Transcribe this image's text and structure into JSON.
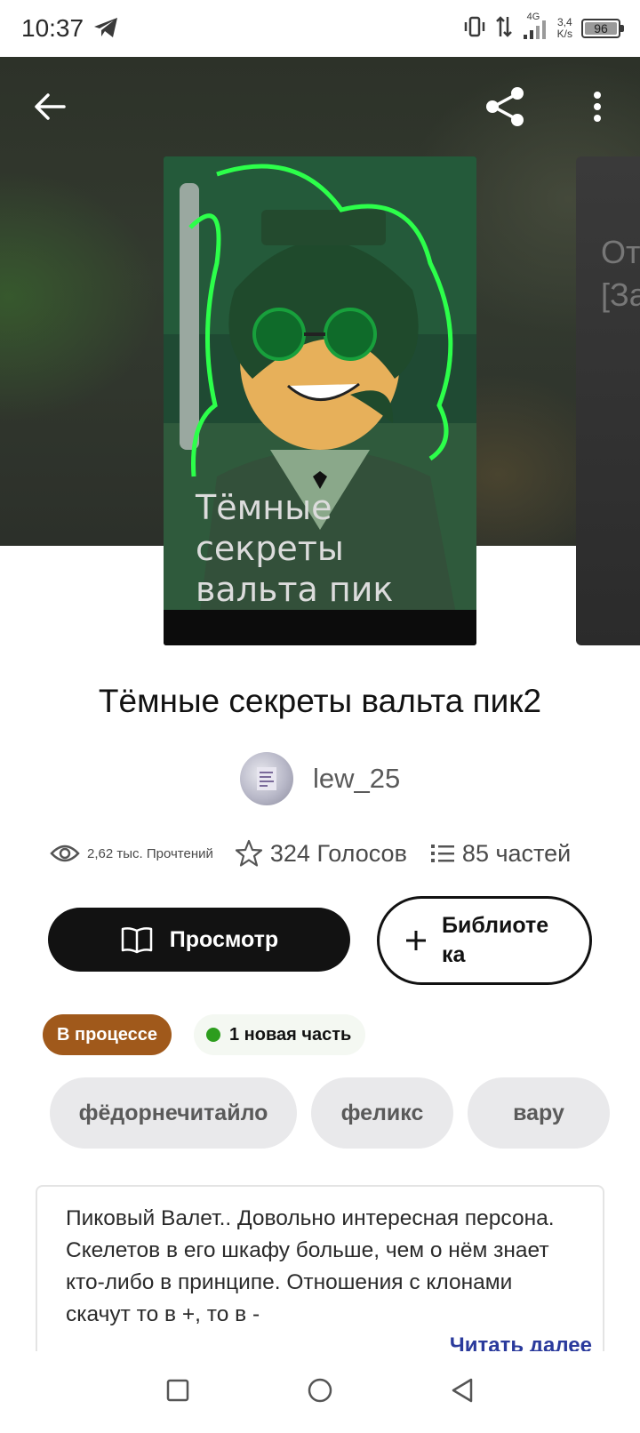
{
  "status_bar": {
    "time": "10:37",
    "network": "4G",
    "speed_value": "3,4",
    "speed_unit": "K/s",
    "battery": "96"
  },
  "cover": {
    "title_text": "Тёмные\nсекреты\nвальта пик",
    "next_cover_text": "От\n[За"
  },
  "story": {
    "title": "Тёмные секреты вальта пик2",
    "author": "lew_25"
  },
  "stats": {
    "reads": "2,62 тыс. Прочтений",
    "votes": "324 Голосов",
    "parts": "85 частей"
  },
  "actions": {
    "read_label": "Просмотр",
    "library_label": "Библиоте ка"
  },
  "badges": {
    "status": "В процессе",
    "new_parts": "1 новая часть"
  },
  "tags": [
    "фёдорнечитайло",
    "феликс",
    "вару"
  ],
  "description": {
    "text": "Пиковый Валет.. Довольно интересная персона. Скелетов в его шкафу больше, чем о нём знает кто-либо в принципе. Отношения с клонами скачут то в +, то в -",
    "read_more": "Читать далее"
  },
  "colors": {
    "status_badge": "#a0591b",
    "new_dot": "#2d9d1e",
    "read_more": "#2a3a9c",
    "primary_button": "#121212"
  },
  "icons": {
    "back": "arrow-left-icon",
    "share": "share-icon",
    "more": "more-vertical-icon",
    "reads": "eye-icon",
    "votes": "star-icon",
    "parts": "list-icon",
    "read": "book-icon",
    "library": "plus-icon"
  }
}
